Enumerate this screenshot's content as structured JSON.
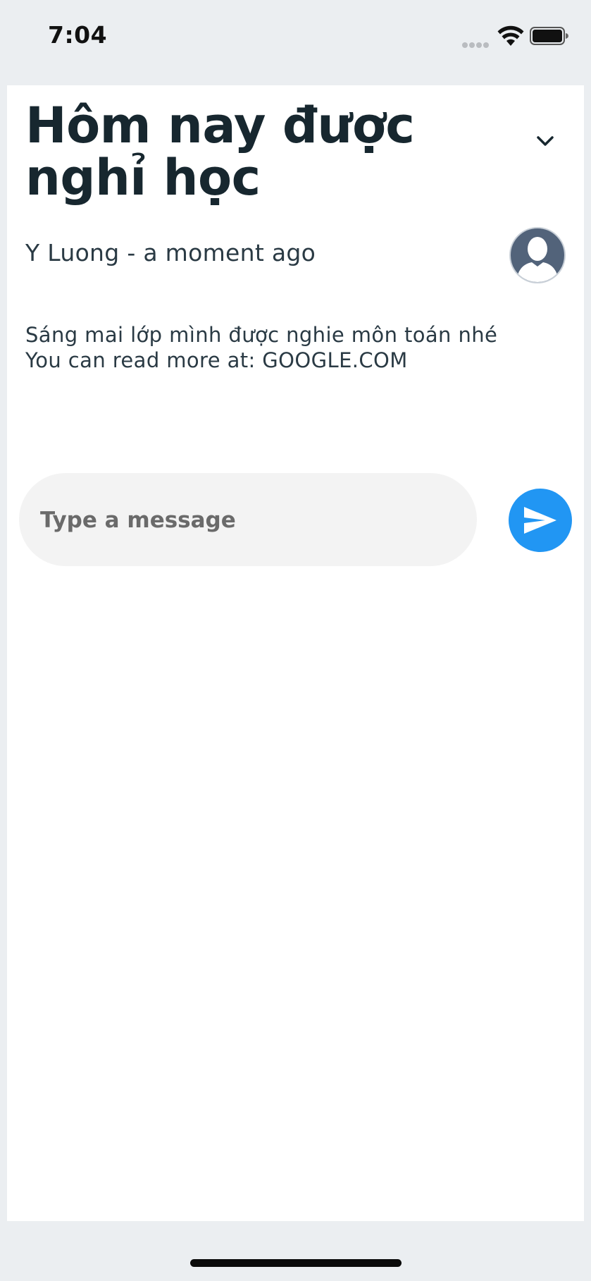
{
  "status_bar": {
    "time": "7:04"
  },
  "post": {
    "title": "Hôm nay được nghỉ học",
    "author": "Y Luong",
    "separator": " - ",
    "timestamp": "a moment ago",
    "body_lines": [
      "Sáng mai lớp mình được nghie môn toán nhé",
      "You can read more at: GOOGLE.COM"
    ]
  },
  "composer": {
    "placeholder": "Type a message",
    "value": ""
  },
  "icons": {
    "collapse": "chevron-down-icon",
    "avatar": "user-avatar-icon",
    "send": "send-icon",
    "wifi": "wifi-icon",
    "battery": "battery-icon"
  },
  "colors": {
    "accent": "#2196f3",
    "avatar_bg": "#52637a",
    "title_text": "#17272f",
    "input_bg": "#f3f3f3",
    "page_bg": "#ebeef1"
  }
}
